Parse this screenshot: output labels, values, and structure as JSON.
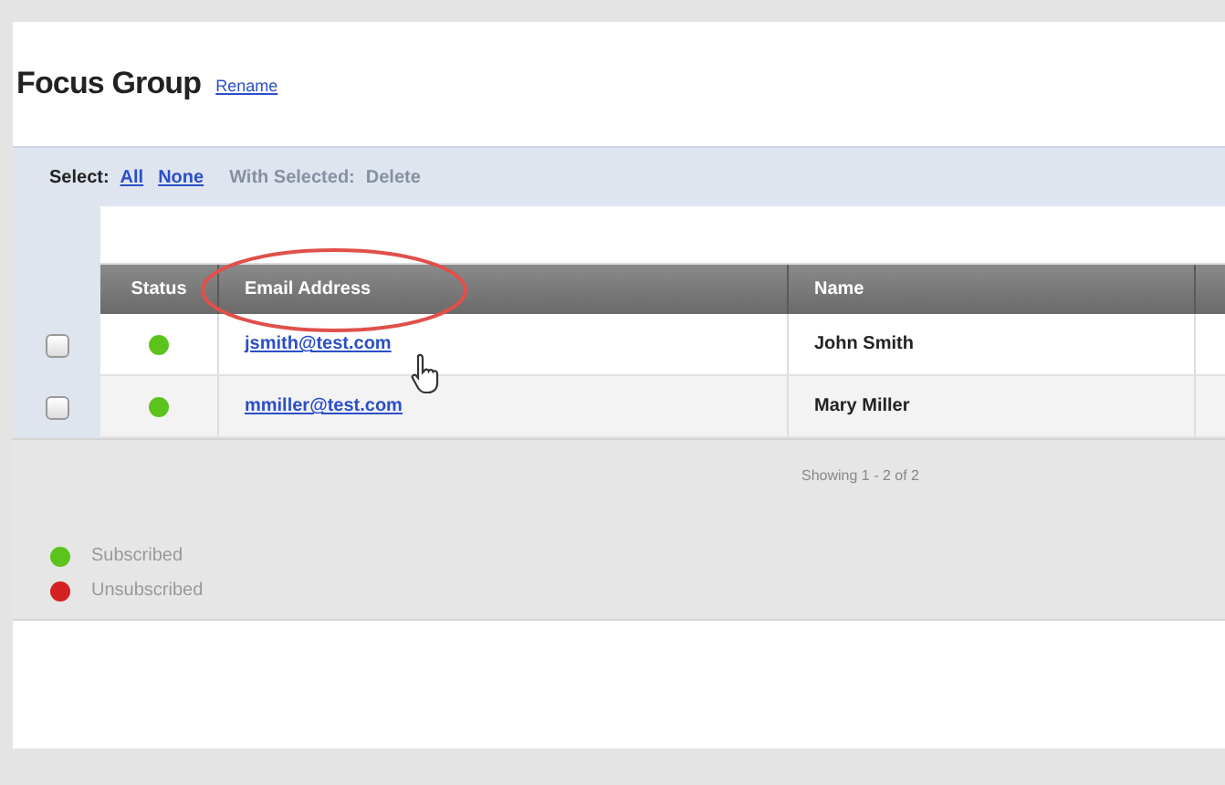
{
  "title": "Focus Group",
  "rename_link": "Rename",
  "toolbar": {
    "select_label": "Select:",
    "all_link": "All",
    "none_link": "None",
    "with_selected": "With Selected:",
    "delete_action": {
      "label": "Delete",
      "disabled": true
    }
  },
  "table": {
    "columns": [
      "Status",
      "Email Address",
      "Name"
    ],
    "rows": [
      {
        "checked": false,
        "color": "#5cc31c",
        "email": "jsmith@test.com",
        "name": "John Smith"
      },
      {
        "checked": false,
        "color": "#5cc31c",
        "email": "mmiller@test.com",
        "name": "Mary Miller"
      }
    ]
  },
  "pagination": "Showing 1 - 2 of 2",
  "legend": [
    {
      "label": "Subscribed",
      "color": "#5cc31c"
    },
    {
      "label": "Unsubscribed",
      "color": "#d42020"
    }
  ]
}
